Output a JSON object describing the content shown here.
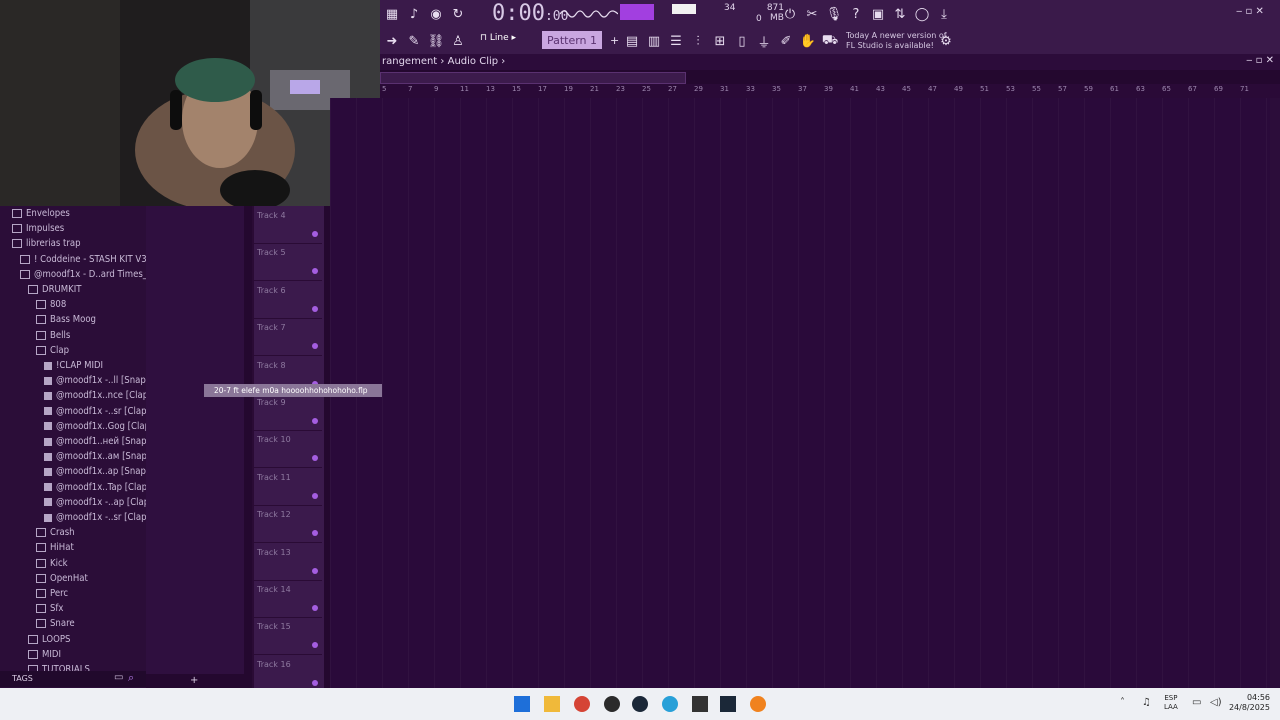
{
  "transport": {
    "time_main": "0:00",
    "time_sub": ":00",
    "time_unit_label": "MS:CS",
    "cpu": "34",
    "poly": "0",
    "memory": "871 MB",
    "mem_sub": "0"
  },
  "toolbar": {
    "snap_mode": "Line",
    "pattern": "Pattern 1",
    "news_line1": "Today  A newer version of",
    "news_line2": "FL Studio is available!"
  },
  "breadcrumb": {
    "part1": "rangement",
    "sep": "›",
    "part2": "Audio Clip",
    "arrow": "›"
  },
  "ruler_ticks": [
    "5",
    "7",
    "9",
    "11",
    "13",
    "15",
    "17",
    "19",
    "21",
    "23",
    "25",
    "27",
    "29",
    "31",
    "33",
    "35",
    "37",
    "39",
    "41",
    "43",
    "45",
    "47",
    "49",
    "51",
    "53",
    "55",
    "57",
    "59",
    "61",
    "63",
    "65",
    "67",
    "69",
    "71"
  ],
  "browser": {
    "items": [
      {
        "label": "Envelopes",
        "type": "folder",
        "indent": 1
      },
      {
        "label": "Impulses",
        "type": "folder",
        "indent": 1
      },
      {
        "label": "librerias trap",
        "type": "folder",
        "indent": 1
      },
      {
        "label": "! Coddeine - STASH KIT V3 !",
        "type": "folder",
        "indent": 2
      },
      {
        "label": "@moodf1x - D..ard Times_",
        "type": "folder",
        "indent": 2
      },
      {
        "label": "DRUMKIT",
        "type": "folder",
        "indent": 3
      },
      {
        "label": "808",
        "type": "folder",
        "indent": 4
      },
      {
        "label": "Bass Moog",
        "type": "folder",
        "indent": 4
      },
      {
        "label": "Bells",
        "type": "folder",
        "indent": 4
      },
      {
        "label": "Clap",
        "type": "folder",
        "indent": 4
      },
      {
        "label": "!CLAP MIDI",
        "type": "file",
        "indent": 5
      },
      {
        "label": "@moodf1x -..ll [Snap]",
        "type": "file",
        "indent": 5
      },
      {
        "label": "@moodf1x..nce [Clap]",
        "type": "file",
        "indent": 5
      },
      {
        "label": "@moodf1x -..sr [Clap]",
        "type": "file",
        "indent": 5
      },
      {
        "label": "@moodf1x..Gog [Clap]",
        "type": "file",
        "indent": 5
      },
      {
        "label": "@moodf1..ней [Snap]",
        "type": "file",
        "indent": 5
      },
      {
        "label": "@moodf1x..aм [Snap]",
        "type": "file",
        "indent": 5
      },
      {
        "label": "@moodf1x..ap [Snap]",
        "type": "file",
        "indent": 5
      },
      {
        "label": "@moodf1x..Tap [Clap]",
        "type": "file",
        "indent": 5
      },
      {
        "label": "@moodf1x -..ap [Clap]",
        "type": "file",
        "indent": 5
      },
      {
        "label": "@moodf1x -..sr [Clap]",
        "type": "file",
        "indent": 5
      },
      {
        "label": "Crash",
        "type": "folder",
        "indent": 4
      },
      {
        "label": "HiHat",
        "type": "folder",
        "indent": 4
      },
      {
        "label": "Kick",
        "type": "folder",
        "indent": 4
      },
      {
        "label": "OpenHat",
        "type": "folder",
        "indent": 4
      },
      {
        "label": "Perc",
        "type": "folder",
        "indent": 4
      },
      {
        "label": "Sfx",
        "type": "folder",
        "indent": 4
      },
      {
        "label": "Snare",
        "type": "folder",
        "indent": 4
      },
      {
        "label": "LOOPS",
        "type": "folder",
        "indent": 3
      },
      {
        "label": "MIDI",
        "type": "folder",
        "indent": 3
      },
      {
        "label": "TUTORIALS",
        "type": "folder",
        "indent": 3
      }
    ],
    "tags_label": "TAGS"
  },
  "tracks": [
    "Track 4",
    "Track 5",
    "Track 6",
    "Track 7",
    "Track 8",
    "Track 9",
    "Track 10",
    "Track 11",
    "Track 12",
    "Track 13",
    "Track 14",
    "Track 15",
    "Track 16"
  ],
  "drag_hint": "20-7 ft elefe m0a hoooohhohohohoho.flp",
  "taskbar": {
    "lang1": "ESP",
    "lang2": "LAA",
    "time": "04:56",
    "date": "24/8/2025"
  },
  "colors": {
    "accent": "#a23fe0",
    "panel": "#3a1a4a",
    "playlist_bg": "#2a0a3a"
  }
}
